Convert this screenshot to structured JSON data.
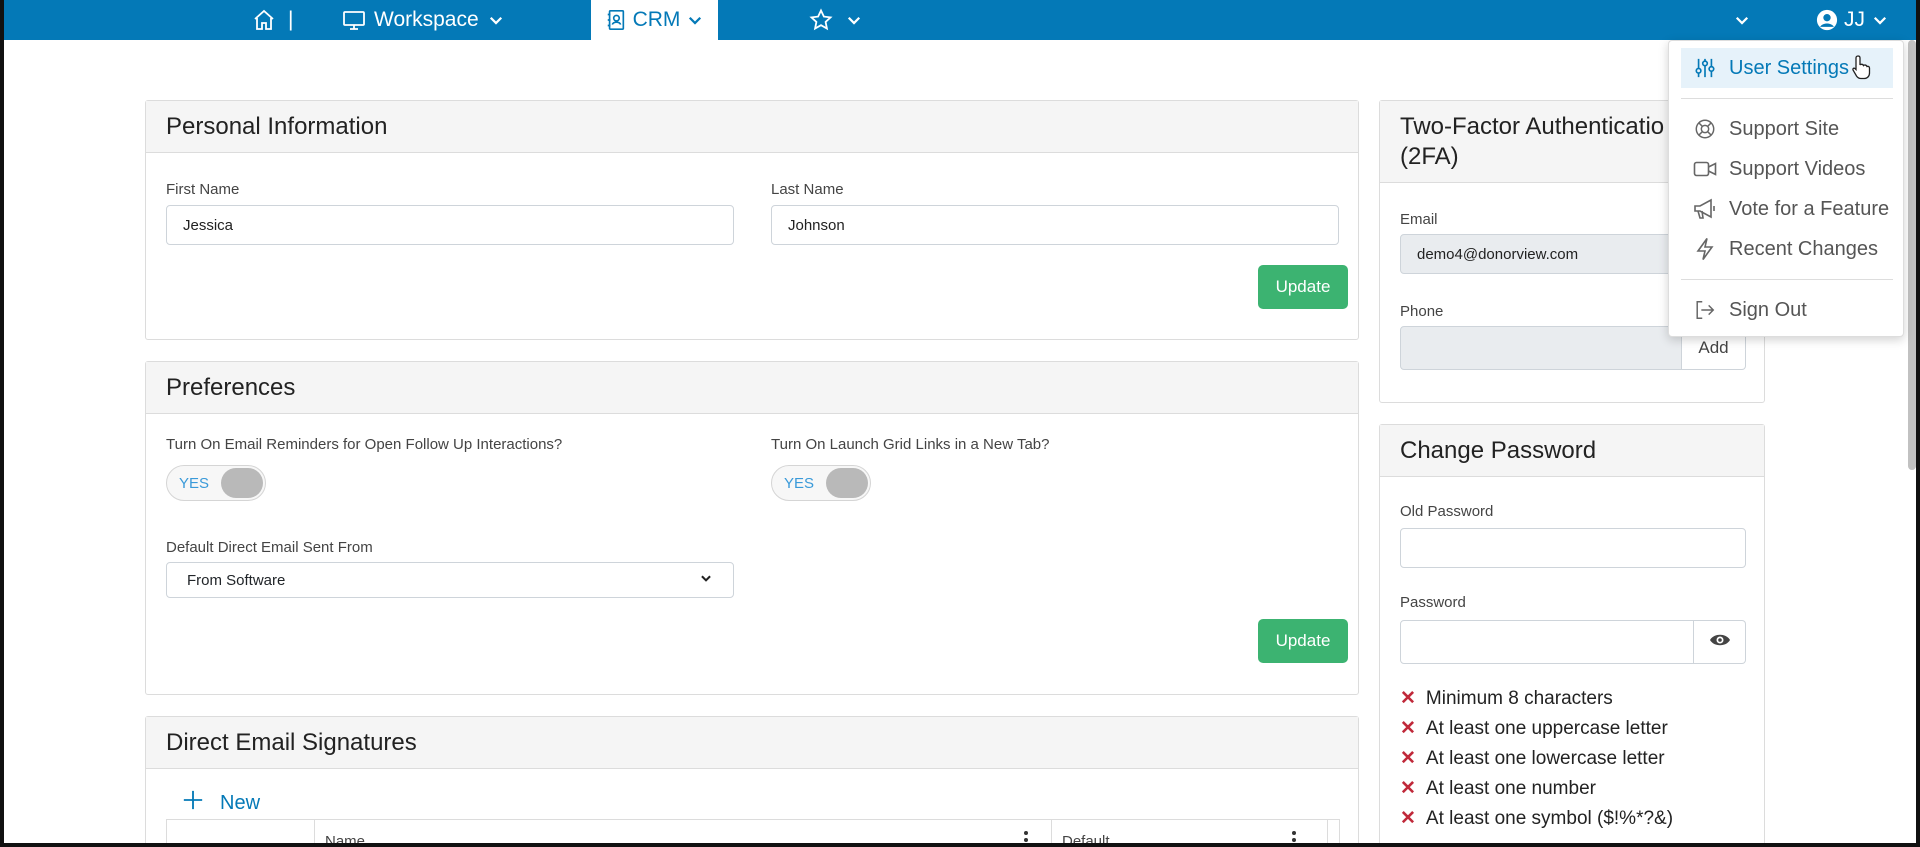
{
  "topbar": {
    "home_separator": "|",
    "workspace_label": "Workspace",
    "crm_label": "CRM",
    "user_initials": "JJ"
  },
  "personal_info": {
    "title": "Personal Information",
    "first_name_label": "First Name",
    "first_name_value": "Jessica",
    "last_name_label": "Last Name",
    "last_name_value": "Johnson",
    "update_label": "Update"
  },
  "preferences": {
    "title": "Preferences",
    "email_reminders_label": "Turn On Email Reminders for Open Follow Up Interactions?",
    "email_reminders_toggle": "YES",
    "grid_links_label": "Turn On Launch Grid Links in a New Tab?",
    "grid_links_toggle": "YES",
    "default_email_label": "Default Direct Email Sent From",
    "default_email_value": "From Software",
    "update_label": "Update"
  },
  "signatures": {
    "title": "Direct Email Signatures",
    "new_label": "New",
    "columns": [
      "Name",
      "Default"
    ]
  },
  "twofa": {
    "title_line1": "Two-Factor Authenticatio",
    "title_line2": "(2FA)",
    "email_label": "Email",
    "email_value": "demo4@donorview.com",
    "phone_label": "Phone",
    "phone_value": "",
    "add_label": "Add"
  },
  "change_password": {
    "title": "Change Password",
    "old_password_label": "Old Password",
    "password_label": "Password",
    "requirements": [
      "Minimum 8 characters",
      "At least one uppercase letter",
      "At least one lowercase letter",
      "At least one number",
      "At least one symbol ($!%*?&)"
    ]
  },
  "user_menu": {
    "items": [
      {
        "label": "User Settings",
        "icon": "sliders-icon"
      },
      {
        "label": "Support Site",
        "icon": "lifebuoy-icon"
      },
      {
        "label": "Support Videos",
        "icon": "video-icon"
      },
      {
        "label": "Vote for a Feature",
        "icon": "megaphone-icon"
      },
      {
        "label": "Recent Changes",
        "icon": "lightning-icon"
      },
      {
        "label": "Sign Out",
        "icon": "sign-out-icon"
      }
    ]
  },
  "colors": {
    "topbar": "#0479b7",
    "accent_green": "#3cb371",
    "error_red": "#c0293a"
  }
}
